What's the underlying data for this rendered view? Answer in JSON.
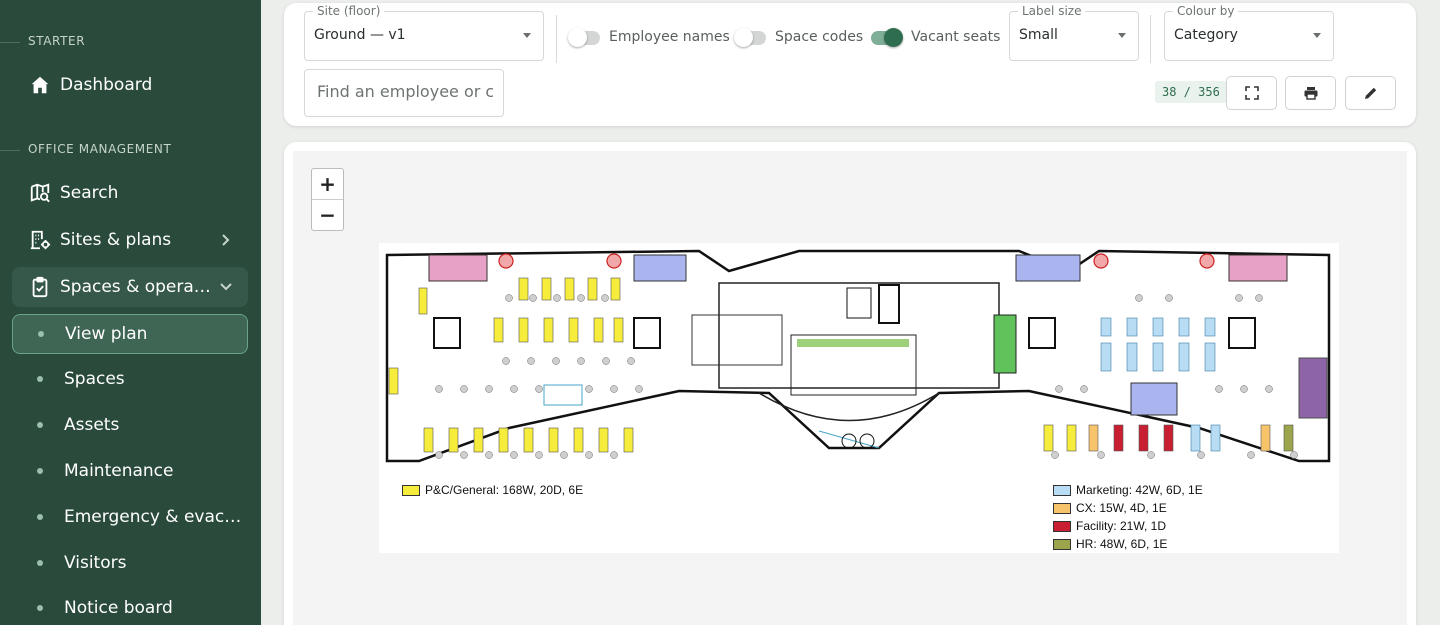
{
  "sidebar": {
    "sections": [
      {
        "label": "STARTER"
      },
      {
        "label": "OFFICE MANAGEMENT"
      }
    ],
    "items": [
      {
        "label": "Dashboard",
        "icon": "home-icon"
      },
      {
        "label": "Search",
        "icon": "map-search-icon"
      },
      {
        "label": "Sites & plans",
        "icon": "building-gear-icon"
      },
      {
        "label": "Spaces & operations",
        "icon": "clipboard-check-icon"
      },
      {
        "label": "View plan"
      },
      {
        "label": "Spaces"
      },
      {
        "label": "Assets"
      },
      {
        "label": "Maintenance"
      },
      {
        "label": "Emergency & evacuation"
      },
      {
        "label": "Visitors"
      },
      {
        "label": "Notice board"
      }
    ]
  },
  "toolbar": {
    "site": {
      "legend": "Site (floor)",
      "value": "Ground — v1"
    },
    "toggles": [
      {
        "label": "Employee names",
        "on": false
      },
      {
        "label": "Space codes",
        "on": false
      },
      {
        "label": "Vacant seats",
        "on": true
      }
    ],
    "label_size": {
      "legend": "Label size",
      "value": "Small"
    },
    "colour_by": {
      "legend": "Colour by",
      "value": "Category"
    },
    "search_placeholder": "Find an employee or code",
    "count": "38 / 356",
    "buttons": [
      "fullscreen-icon",
      "print-icon",
      "edit-pencil-icon"
    ]
  },
  "plan": {
    "zoom_in": "+",
    "zoom_out": "−",
    "legend": [
      {
        "label": "P&C/General: 168W, 20D, 6E",
        "color": "#f5ec3c"
      },
      {
        "label": "Marketing: 42W, 6D, 1E",
        "color": "#b7dcf3"
      },
      {
        "label": "CX: 15W, 4D, 1E",
        "color": "#f7c46b"
      },
      {
        "label": "Facility: 21W, 1D",
        "color": "#c81f32"
      },
      {
        "label": "HR: 48W, 6D, 1E",
        "color": "#9ca44c"
      }
    ]
  },
  "colors": {
    "sidebar_bg": "#2a4b3c",
    "accent": "#2f6d50"
  }
}
